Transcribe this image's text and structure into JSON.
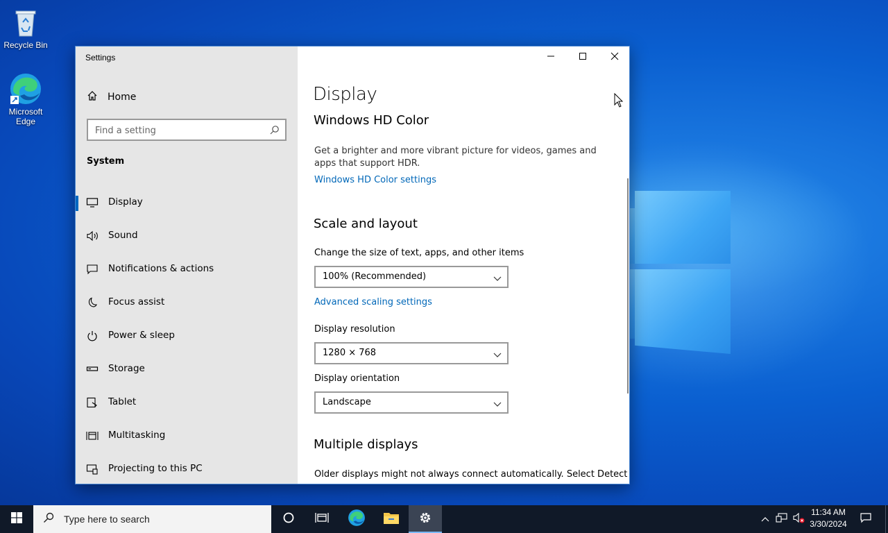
{
  "desktop": {
    "icons": [
      {
        "label": "Recycle Bin"
      },
      {
        "label": "Microsoft Edge"
      }
    ]
  },
  "window": {
    "title": "Settings",
    "sidebar": {
      "home_label": "Home",
      "search_placeholder": "Find a setting",
      "section": "System",
      "items": [
        {
          "label": "Display",
          "icon": "monitor-icon",
          "selected": true
        },
        {
          "label": "Sound",
          "icon": "speaker-icon"
        },
        {
          "label": "Notifications & actions",
          "icon": "notification-icon"
        },
        {
          "label": "Focus assist",
          "icon": "moon-icon"
        },
        {
          "label": "Power & sleep",
          "icon": "power-icon"
        },
        {
          "label": "Storage",
          "icon": "storage-icon"
        },
        {
          "label": "Tablet",
          "icon": "tablet-icon"
        },
        {
          "label": "Multitasking",
          "icon": "multitasking-icon"
        },
        {
          "label": "Projecting to this PC",
          "icon": "projecting-icon"
        }
      ]
    },
    "content": {
      "page_title": "Display",
      "hdr_heading": "Windows HD Color",
      "hdr_desc": "Get a brighter and more vibrant picture for videos, games and apps that support HDR.",
      "hdr_link": "Windows HD Color settings",
      "scale_heading": "Scale and layout",
      "scale_label": "Change the size of text, apps, and other items",
      "scale_value": "100% (Recommended)",
      "advanced_link": "Advanced scaling settings",
      "resolution_label": "Display resolution",
      "resolution_value": "1280 × 768",
      "orientation_label": "Display orientation",
      "orientation_value": "Landscape",
      "multi_heading": "Multiple displays",
      "multi_desc": "Older displays might not always connect automatically. Select Detect"
    }
  },
  "taskbar": {
    "search_placeholder": "Type here to search",
    "time": "11:34 AM",
    "date": "3/30/2024"
  },
  "colors": {
    "accent": "#0067c0",
    "link": "#0067b8",
    "taskbar": "#101928",
    "sidebar": "#e6e6e6"
  }
}
